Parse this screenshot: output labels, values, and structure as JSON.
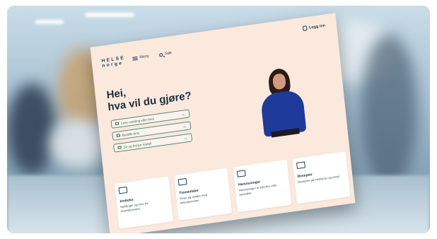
{
  "header": {
    "logo_line1": "HELSE",
    "logo_line2": "norge",
    "menu_label": "Meny",
    "search_label": "Søk",
    "login_label": "Logg inn"
  },
  "hero": {
    "title_line1": "Hei,",
    "title_line2": "hva vil du gjøre?"
  },
  "actions": [
    {
      "label": "Lese melding eller brev",
      "icon": "envelope-icon"
    },
    {
      "label": "Bestille time",
      "icon": "calendar-icon"
    },
    {
      "label": "Se og fornye resept",
      "icon": "prescription-icon"
    }
  ],
  "cards": [
    {
      "title": "Innboks",
      "desc": "Meldinger og brev fra helsetjenesten.",
      "icon": "envelope-icon"
    },
    {
      "title": "Timeavtaler",
      "desc": "Timer og avtaler med helsetjenesten.",
      "icon": "calendar-icon"
    },
    {
      "title": "Henvisninger",
      "desc": "Henvisninger til sykehus eller spesialist.",
      "icon": "referral-icon"
    },
    {
      "title": "Resepter",
      "desc": "Resepter på medisiner og utstyr.",
      "icon": "prescription-icon"
    }
  ],
  "colors": {
    "screen_bg": "#fbe9de",
    "accent_green": "#2d6b5a",
    "text_dark": "#1b2f3d",
    "navy": "#1d3b4d"
  }
}
